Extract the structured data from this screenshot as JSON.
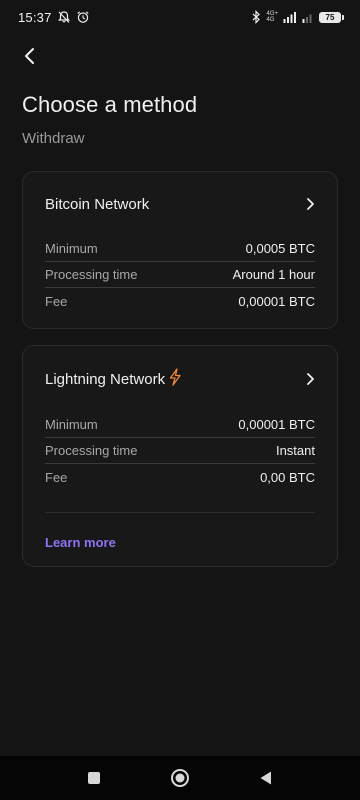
{
  "status_bar": {
    "time": "15:37",
    "network_top": "4G+",
    "network_bottom": "4G",
    "battery": "75",
    "icons": [
      "muted-notification-icon",
      "alarm-icon",
      "bluetooth-icon",
      "signal-icon",
      "wifi-signal-icon"
    ]
  },
  "header": {
    "back_icon": "chevron-left-icon",
    "title": "Choose a method",
    "subtitle": "Withdraw"
  },
  "methods": [
    {
      "title": "Bitcoin Network",
      "icon": "chevron-right-icon",
      "rows": [
        {
          "label": "Minimum",
          "value": "0,0005 BTC"
        },
        {
          "label": "Processing time",
          "value": "Around 1 hour"
        },
        {
          "label": "Fee",
          "value": "0,00001 BTC"
        }
      ]
    },
    {
      "title": "Lightning Network",
      "title_icon": "lightning-bolt-icon",
      "icon": "chevron-right-icon",
      "rows": [
        {
          "label": "Minimum",
          "value": "0,00001 BTC"
        },
        {
          "label": "Processing time",
          "value": "Instant"
        },
        {
          "label": "Fee",
          "value": "0,00 BTC"
        }
      ],
      "link": "Learn more"
    }
  ],
  "nav_bar": {
    "icons": [
      "recent-apps-square-icon",
      "home-circle-icon",
      "back-triangle-icon"
    ]
  },
  "colors": {
    "background": "#141414",
    "card_background": "#181818",
    "card_border": "#2b2b2b",
    "link": "#8f73f2",
    "lightning": "#f08a3c",
    "muted_text": "#a8a8a8"
  }
}
